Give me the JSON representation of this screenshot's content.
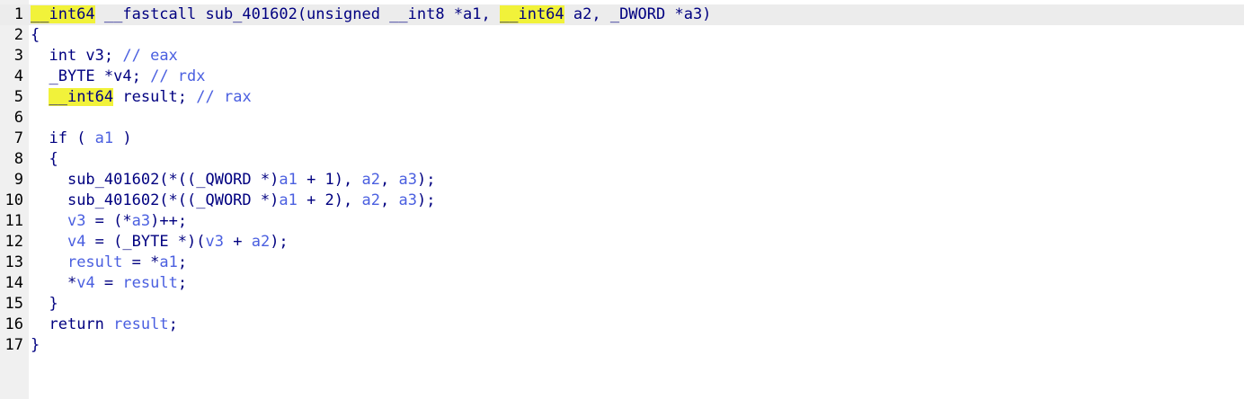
{
  "editor": {
    "lines": [
      {
        "num": "1",
        "indent": "",
        "tokens": [
          {
            "t": "__int64",
            "c": "hl"
          },
          {
            "t": " __fastcall sub_401602(unsigned __int8 *a1, ",
            "c": "pl"
          },
          {
            "t": "__int64",
            "c": "hl"
          },
          {
            "t": " a2, _DWORD *a3)",
            "c": "pl"
          }
        ]
      },
      {
        "num": "2",
        "indent": "",
        "tokens": [
          {
            "t": "{",
            "c": "pl"
          }
        ]
      },
      {
        "num": "3",
        "indent": "  ",
        "tokens": [
          {
            "t": "int v3; ",
            "c": "pl"
          },
          {
            "t": "// eax",
            "c": "var"
          }
        ]
      },
      {
        "num": "4",
        "indent": "  ",
        "tokens": [
          {
            "t": "_BYTE *v4; ",
            "c": "pl"
          },
          {
            "t": "// rdx",
            "c": "var"
          }
        ]
      },
      {
        "num": "5",
        "indent": "  ",
        "tokens": [
          {
            "t": "__int64",
            "c": "hl"
          },
          {
            "t": " result; ",
            "c": "pl"
          },
          {
            "t": "// rax",
            "c": "var"
          }
        ]
      },
      {
        "num": "6",
        "indent": "",
        "tokens": []
      },
      {
        "num": "7",
        "indent": "  ",
        "tokens": [
          {
            "t": "if ( ",
            "c": "pl"
          },
          {
            "t": "a1",
            "c": "var"
          },
          {
            "t": " )",
            "c": "pl"
          }
        ]
      },
      {
        "num": "8",
        "indent": "  ",
        "tokens": [
          {
            "t": "{",
            "c": "pl"
          }
        ]
      },
      {
        "num": "9",
        "indent": "    ",
        "tokens": [
          {
            "t": "sub_401602(*((_QWORD *)",
            "c": "pl"
          },
          {
            "t": "a1",
            "c": "var"
          },
          {
            "t": " + 1), ",
            "c": "pl"
          },
          {
            "t": "a2",
            "c": "var"
          },
          {
            "t": ", ",
            "c": "pl"
          },
          {
            "t": "a3",
            "c": "var"
          },
          {
            "t": ");",
            "c": "pl"
          }
        ]
      },
      {
        "num": "10",
        "indent": "    ",
        "tokens": [
          {
            "t": "sub_401602(*((_QWORD *)",
            "c": "pl"
          },
          {
            "t": "a1",
            "c": "var"
          },
          {
            "t": " + 2), ",
            "c": "pl"
          },
          {
            "t": "a2",
            "c": "var"
          },
          {
            "t": ", ",
            "c": "pl"
          },
          {
            "t": "a3",
            "c": "var"
          },
          {
            "t": ");",
            "c": "pl"
          }
        ]
      },
      {
        "num": "11",
        "indent": "    ",
        "tokens": [
          {
            "t": "v3",
            "c": "var"
          },
          {
            "t": " = (*",
            "c": "pl"
          },
          {
            "t": "a3",
            "c": "var"
          },
          {
            "t": ")++;",
            "c": "pl"
          }
        ]
      },
      {
        "num": "12",
        "indent": "    ",
        "tokens": [
          {
            "t": "v4",
            "c": "var"
          },
          {
            "t": " = (_BYTE *)(",
            "c": "pl"
          },
          {
            "t": "v3",
            "c": "var"
          },
          {
            "t": " + ",
            "c": "pl"
          },
          {
            "t": "a2",
            "c": "var"
          },
          {
            "t": ");",
            "c": "pl"
          }
        ]
      },
      {
        "num": "13",
        "indent": "    ",
        "tokens": [
          {
            "t": "result",
            "c": "var"
          },
          {
            "t": " = *",
            "c": "pl"
          },
          {
            "t": "a1",
            "c": "var"
          },
          {
            "t": ";",
            "c": "pl"
          }
        ]
      },
      {
        "num": "14",
        "indent": "    ",
        "tokens": [
          {
            "t": "*",
            "c": "pl"
          },
          {
            "t": "v4",
            "c": "var"
          },
          {
            "t": " = ",
            "c": "pl"
          },
          {
            "t": "result",
            "c": "var"
          },
          {
            "t": ";",
            "c": "pl"
          }
        ]
      },
      {
        "num": "15",
        "indent": "  ",
        "tokens": [
          {
            "t": "}",
            "c": "pl"
          }
        ]
      },
      {
        "num": "16",
        "indent": "  ",
        "tokens": [
          {
            "t": "return ",
            "c": "pl"
          },
          {
            "t": "result",
            "c": "var"
          },
          {
            "t": ";",
            "c": "pl"
          }
        ]
      },
      {
        "num": "17",
        "indent": "",
        "tokens": [
          {
            "t": "}",
            "c": "pl"
          }
        ]
      }
    ]
  }
}
